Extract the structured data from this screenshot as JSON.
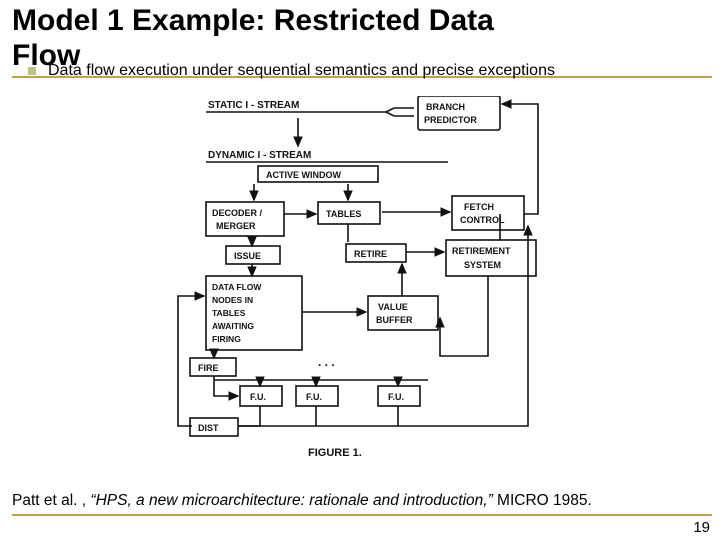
{
  "title_line1": "Model 1 Example: Restricted Data",
  "title_line2": "Flow",
  "bullet": "Data flow execution under sequential semantics and precise exceptions",
  "diagram": {
    "heading_static": "STATIC  I - STREAM",
    "branch_predictor": "BRANCH\nPREDICTOR",
    "heading_dynamic": "DYNAMIC  I - STREAM",
    "active_window": "ACTIVE WINDOW",
    "decoder_merger": "DECODER /\nMERGER",
    "tables": "TABLES",
    "fetch_control": "FETCH\nCONTROL",
    "issue": "ISSUE",
    "retire": "RETIRE",
    "retirement_system": "RETIREMENT\nSYSTEM",
    "dataflow_nodes": "DATA FLOW\nNODES  IN\nTABLES\nAWAITING\nFIRING",
    "value_buffer": "VALUE\nBUFFER",
    "fire": "FIRE",
    "fu": "F.U.",
    "dots": ". . .",
    "dist": "DIST",
    "figure": "FIGURE 1."
  },
  "citation_prefix": "Patt et al. , ",
  "citation_title": "“HPS, a new microarchitecture: rationale and introduction,”",
  "citation_suffix": " MICRO 1985.",
  "page_number": "19"
}
